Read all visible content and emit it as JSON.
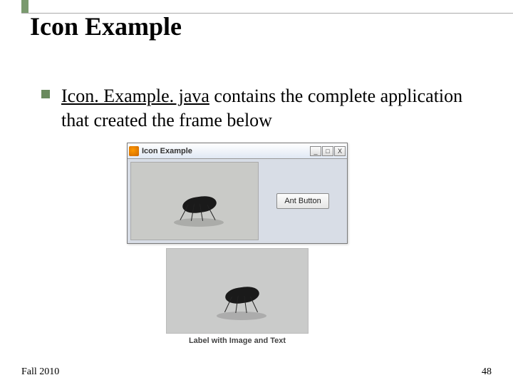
{
  "slide": {
    "title": "Icon Example",
    "bullet_link": "Icon. Example. java",
    "bullet_rest": " contains the complete application that created the frame below"
  },
  "window": {
    "title": "Icon Example",
    "min": "_",
    "max": "□",
    "close": "X",
    "button_label": "Ant Button"
  },
  "lower": {
    "caption": "Label with Image and Text"
  },
  "footer": {
    "left": "Fall 2010",
    "right": "48"
  }
}
